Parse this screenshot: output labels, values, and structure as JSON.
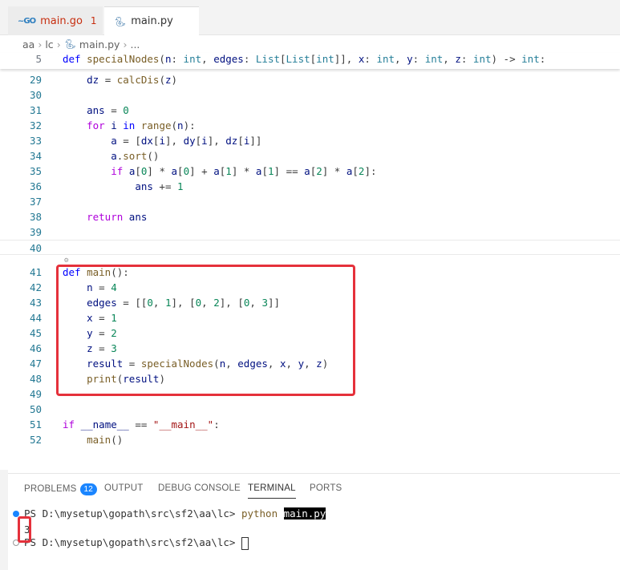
{
  "tabs": [
    {
      "label": "main.go",
      "badge": "1",
      "icon": "go-file-icon"
    },
    {
      "label": "main.py",
      "icon": "python-file-icon"
    }
  ],
  "breadcrumb": [
    "aa",
    "lc",
    "main.py",
    "..."
  ],
  "editor": {
    "sticky": {
      "num": "5",
      "text": "def specialNodes(n: int, edges: List[List[int]], x: int, y: int, z: int) -> int:"
    },
    "lines": [
      {
        "num": "29",
        "text": "    dz = calcDis(z)"
      },
      {
        "num": "30",
        "text": ""
      },
      {
        "num": "31",
        "text": "    ans = 0"
      },
      {
        "num": "32",
        "text": "    for i in range(n):"
      },
      {
        "num": "33",
        "text": "        a = [dx[i], dy[i], dz[i]]"
      },
      {
        "num": "34",
        "text": "        a.sort()"
      },
      {
        "num": "35",
        "text": "        if a[0] * a[0] + a[1] * a[1] == a[2] * a[2]:"
      },
      {
        "num": "36",
        "text": "            ans += 1"
      },
      {
        "num": "37",
        "text": ""
      },
      {
        "num": "38",
        "text": "    return ans"
      },
      {
        "num": "39",
        "text": ""
      },
      {
        "num": "40",
        "text": ""
      },
      {
        "num": "41",
        "text": "def main():"
      },
      {
        "num": "42",
        "text": "    n = 4"
      },
      {
        "num": "43",
        "text": "    edges = [[0, 1], [0, 2], [0, 3]]"
      },
      {
        "num": "44",
        "text": "    x = 1"
      },
      {
        "num": "45",
        "text": "    y = 2"
      },
      {
        "num": "46",
        "text": "    z = 3"
      },
      {
        "num": "47",
        "text": "    result = specialNodes(n, edges, x, y, z)"
      },
      {
        "num": "48",
        "text": "    print(result)"
      },
      {
        "num": "49",
        "text": ""
      },
      {
        "num": "50",
        "text": ""
      },
      {
        "num": "51",
        "text": "if __name__ == \"__main__\":"
      },
      {
        "num": "52",
        "text": "    main()"
      }
    ]
  },
  "panel": {
    "tabs": [
      {
        "label": "PROBLEMS",
        "badge": "12"
      },
      {
        "label": "OUTPUT"
      },
      {
        "label": "DEBUG CONSOLE"
      },
      {
        "label": "TERMINAL",
        "active": true
      },
      {
        "label": "PORTS"
      }
    ],
    "terminal": {
      "prompt1": "PS D:\\mysetup\\gopath\\src\\sf2\\aa\\lc> ",
      "cmd": "python",
      "arg": "main.py",
      "output": "3",
      "prompt2": "PS D:\\mysetup\\gopath\\src\\sf2\\aa\\lc> "
    }
  },
  "colors": {
    "highlight_box": "#e5313b",
    "badge_blue": "#1a85ff",
    "error_red": "#c72e0f"
  }
}
